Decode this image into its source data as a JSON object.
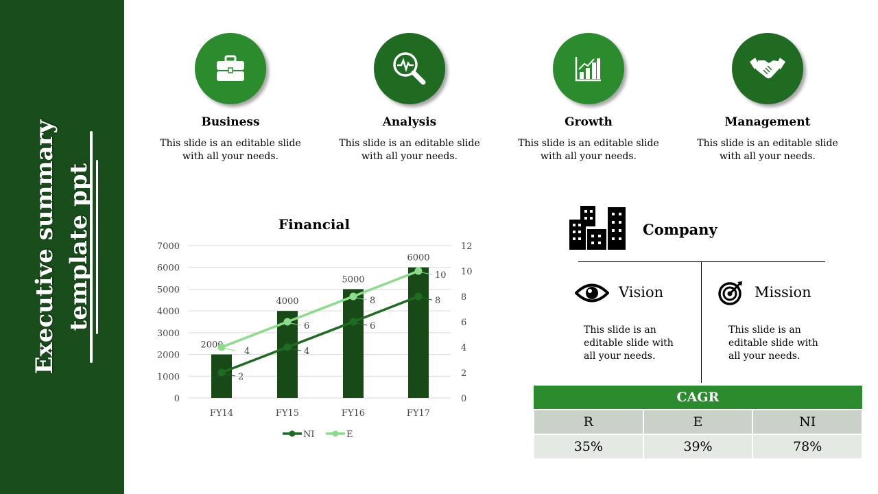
{
  "sidebar": {
    "title_line1": "Executive summary",
    "title_line2": "template ppt"
  },
  "features": [
    {
      "title": "Business",
      "text": "This slide is an editable slide with all your needs.",
      "icon": "briefcase-icon",
      "color": "#2a8c2c"
    },
    {
      "title": "Analysis",
      "text": "This slide is an editable slide with all your needs.",
      "icon": "magnifier-pulse-icon",
      "color": "#1f6b21"
    },
    {
      "title": "Growth",
      "text": "This slide is an editable slide with all your needs.",
      "icon": "bar-chart-growth-icon",
      "color": "#2a8c2c"
    },
    {
      "title": "Management",
      "text": "This slide is an editable slide with all your needs.",
      "icon": "handshake-icon",
      "color": "#1f6b21"
    }
  ],
  "chart_data": {
    "type": "bar",
    "title": "Financial",
    "categories": [
      "FY14",
      "FY15",
      "FY16",
      "FY17"
    ],
    "bars": {
      "values": [
        2000,
        4000,
        5000,
        6000
      ],
      "color": "#174a17"
    },
    "ylim": [
      0,
      7000
    ],
    "yticks": [
      0,
      1000,
      2000,
      3000,
      4000,
      5000,
      6000,
      7000
    ],
    "y2lim": [
      0,
      12
    ],
    "y2ticks": [
      0,
      2,
      4,
      6,
      8,
      10,
      12
    ],
    "series": [
      {
        "name": "NI",
        "type": "line",
        "axis": "secondary",
        "values": [
          2,
          4,
          6,
          8
        ],
        "color": "#1f6b21"
      },
      {
        "name": "E",
        "type": "line",
        "axis": "secondary",
        "values": [
          4,
          6,
          8,
          10
        ],
        "color": "#8cdc8c"
      }
    ],
    "grid": true,
    "legend": "bottom"
  },
  "company": {
    "title": "Company",
    "vision": {
      "label": "Vision",
      "text": "This slide is an editable slide with all your needs."
    },
    "mission": {
      "label": "Mission",
      "text": "This slide is an editable slide with all your needs."
    }
  },
  "cagr": {
    "title": "CAGR",
    "headers": [
      "R",
      "E",
      "NI"
    ],
    "values": [
      "35%",
      "39%",
      "78%"
    ]
  }
}
